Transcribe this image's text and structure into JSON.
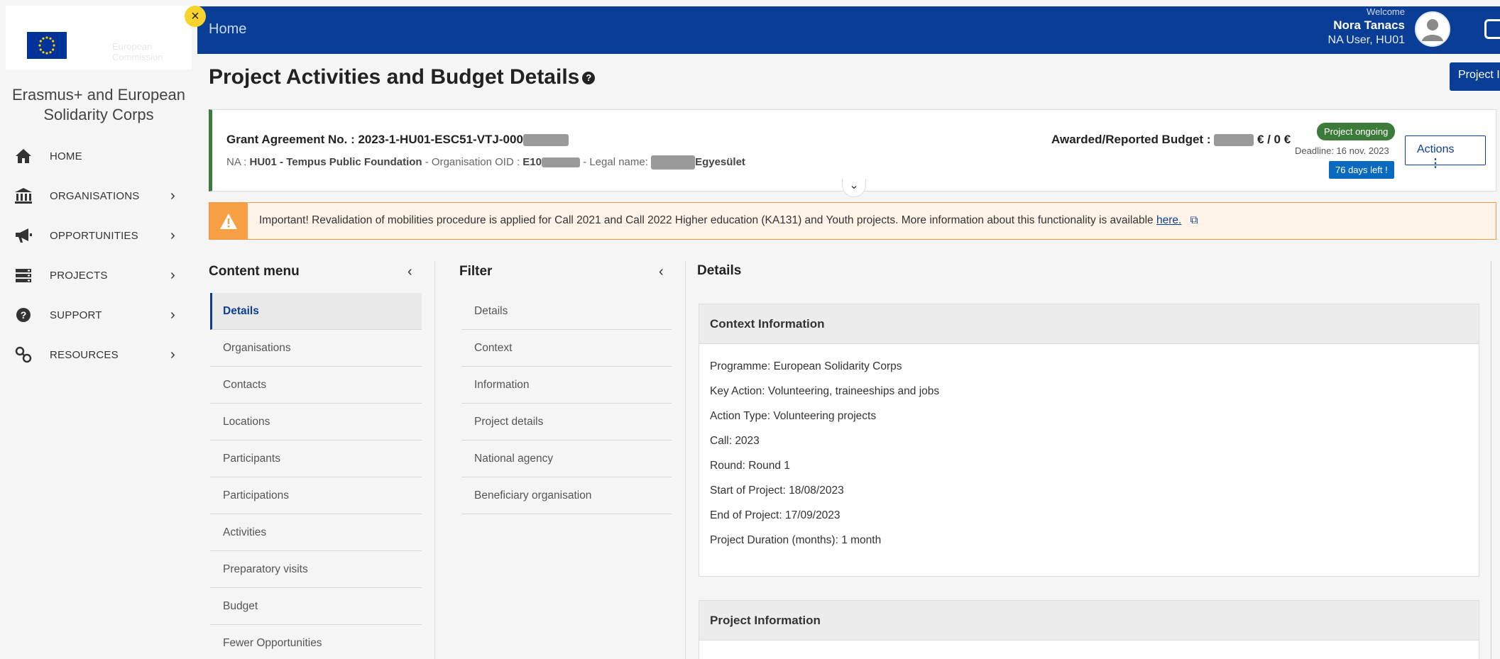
{
  "sidebar": {
    "close_glyph": "×",
    "eu_text": "European Commission",
    "brand_title": "Erasmus+ and European Solidarity Corps",
    "items": [
      {
        "label": "HOME",
        "icon": "home-icon",
        "has_chevron": false
      },
      {
        "label": "ORGANISATIONS",
        "icon": "bank-icon",
        "has_chevron": true
      },
      {
        "label": "OPPORTUNITIES",
        "icon": "megaphone-icon",
        "has_chevron": true
      },
      {
        "label": "PROJECTS",
        "icon": "projects-icon",
        "has_chevron": true
      },
      {
        "label": "SUPPORT",
        "icon": "question-icon",
        "has_chevron": true
      },
      {
        "label": "RESOURCES",
        "icon": "link-icon",
        "has_chevron": true
      }
    ]
  },
  "topbar": {
    "home": "Home",
    "welcome": "Welcome",
    "user_name": "Nora Tanacs",
    "user_role": "NA User, HU01",
    "bg_color": "#0a3e96"
  },
  "page": {
    "title": "Project Activities and Budget Details",
    "project_button": "Project I"
  },
  "grant": {
    "number_label": "Grant Agreement No. : 2023-1-HU01-ESC51-VTJ-000",
    "na_prefix": "NA : ",
    "na_value": "HU01 - Tempus Public Foundation",
    "oid_label": " - Organisation OID : ",
    "oid_value": "E10",
    "legal_label": " - Legal name: ",
    "legal_value": "Egyesület",
    "budget_label": "Awarded/Reported Budget : ",
    "budget_values": "€ / 0 €",
    "status": "Project ongoing",
    "deadline": "Deadline: 16 nov. 2023",
    "days_left": "76 days left !",
    "actions": "Actions"
  },
  "alert": {
    "text": "Important! Revalidation of mobilities procedure is applied for Call 2021 and Call 2022 Higher education (KA131) and Youth projects. More information about this functionality is available ",
    "link": "here."
  },
  "content_menu": {
    "title": "Content menu",
    "items": [
      "Details",
      "Organisations",
      "Contacts",
      "Locations",
      "Participants",
      "Participations",
      "Activities",
      "Preparatory visits",
      "Budget",
      "Fewer Opportunities"
    ]
  },
  "filter": {
    "title": "Filter",
    "items": [
      "Details",
      "Context",
      "Information",
      "Project details",
      "National agency",
      "Beneficiary organisation"
    ]
  },
  "details": {
    "title": "Details",
    "context_title": "Context Information",
    "context_lines": [
      "Programme: European Solidarity Corps",
      "Key Action: Volunteering, traineeships and jobs",
      "Action Type: Volunteering projects",
      "Call: 2023",
      "Round: Round 1",
      "Start of Project: 18/08/2023",
      "End of Project: 17/09/2023",
      "Project Duration (months): 1 month"
    ],
    "project_title": "Project Information"
  }
}
